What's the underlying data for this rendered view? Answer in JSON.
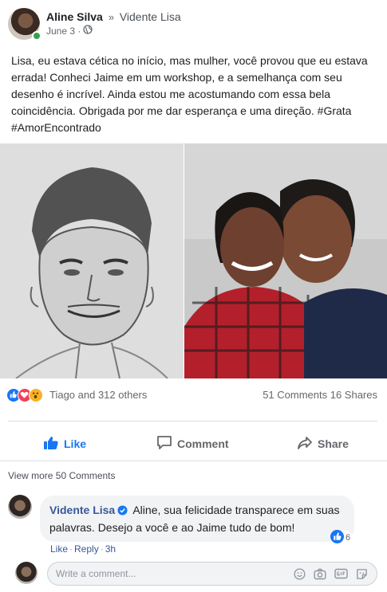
{
  "post": {
    "author": "Aline Silva",
    "separator": "»",
    "target": "Vidente Lisa",
    "date": "June 3 ·",
    "text": "Lisa, eu estava cética no início, mas mulher, você provou que eu estava errada! Conheci Jaime em um workshop, e a semelhança com seu desenho é incrível. Ainda estou me acostumando com essa bela coincidência. Obrigada por me dar esperança e uma direção. #Grata #AmorEncontrado"
  },
  "reactions": {
    "summary": "Tiago and 312 others",
    "comments": "51 Comments",
    "shares": "16 Shares"
  },
  "actions": {
    "like": "Like",
    "comment": "Comment",
    "share": "Share"
  },
  "comments": {
    "view_more": "View more 50 Comments",
    "items": [
      {
        "author": "Vidente Lisa",
        "text": "Aline, sua felicidade transparece em suas palavras. Desejo a você e ao Jaime tudo de bom!",
        "reaction_count": "6",
        "like": "Like",
        "dot": "·",
        "reply": "Reply",
        "time": "3h"
      }
    ]
  },
  "composer": {
    "placeholder": "Write a comment..."
  },
  "colors": {
    "link": "#385898",
    "like_blue": "#1877f2",
    "muted": "#65676b"
  }
}
